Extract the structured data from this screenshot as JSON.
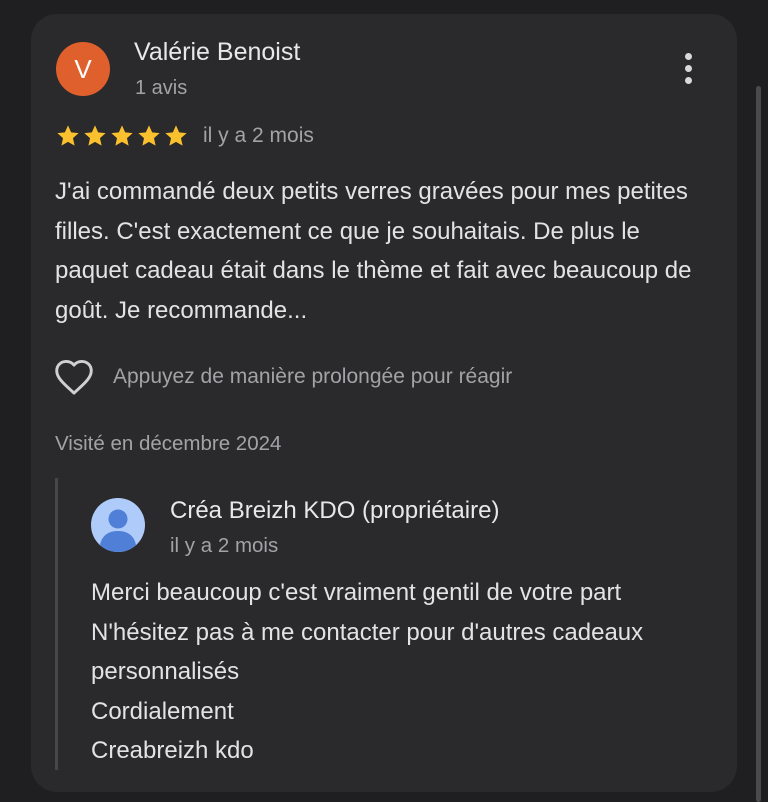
{
  "review": {
    "avatar_letter": "V",
    "avatar_color": "#e0602d",
    "author_name": "Valérie Benoist",
    "review_count": "1 avis",
    "more_icon": "more-vert-icon",
    "rating": 5,
    "rating_max": 5,
    "star_color": "#fbc02d",
    "date": "il y a 2 mois",
    "text": "J'ai commandé deux petits verres gravées pour mes petites filles. C'est exactement ce que je souhaitais. De plus le paquet cadeau était dans le thème et fait avec beaucoup de goût. Je recommande...",
    "react_icon": "heart-outline-icon",
    "react_label": "Appuyez de manière prolongée pour réagir",
    "visit_info": "Visité en décembre 2024"
  },
  "owner_response": {
    "avatar_icon": "person-icon",
    "avatar_color": "#aecbfa",
    "name": "Créa Breizh KDO (propriétaire)",
    "date": "il y a 2 mois",
    "text": "Merci beaucoup c'est vraiment gentil de votre part\nN'hésitez pas à me contacter pour d'autres cadeaux personnalisés\nCordialement\nCreabreizh kdo"
  }
}
